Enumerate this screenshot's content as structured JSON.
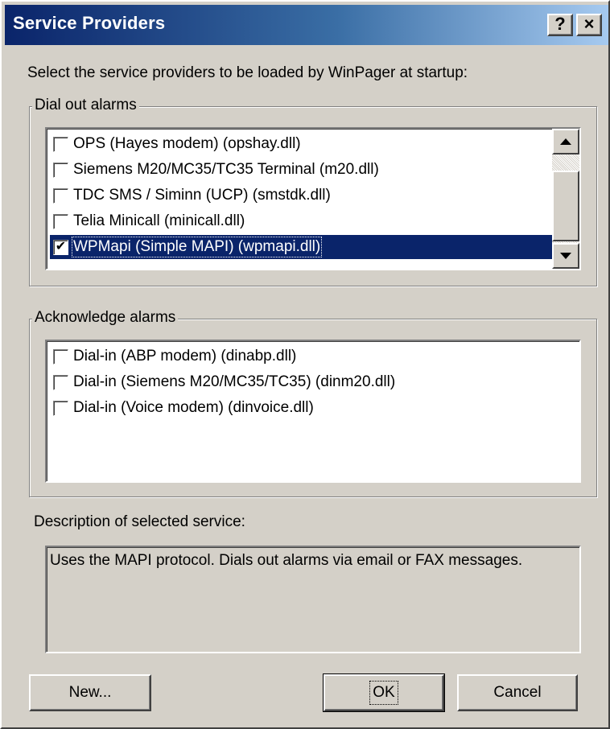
{
  "window": {
    "title": "Service Providers",
    "help_label": "?",
    "close_label": "×"
  },
  "intro_text": "Select the service providers to be loaded by WinPager at startup:",
  "dial_out": {
    "group_label": "Dial out alarms",
    "items": [
      {
        "label": "OPS (Hayes modem)   (opshay.dll)",
        "checked": false,
        "selected": false
      },
      {
        "label": "Siemens M20/MC35/TC35 Terminal   (m20.dll)",
        "checked": false,
        "selected": false
      },
      {
        "label": "TDC SMS / Siminn (UCP)   (smstdk.dll)",
        "checked": false,
        "selected": false
      },
      {
        "label": "Telia Minicall   (minicall.dll)",
        "checked": false,
        "selected": false
      },
      {
        "label": "WPMapi (Simple MAPI)   (wpmapi.dll)",
        "checked": true,
        "selected": true
      }
    ]
  },
  "acknowledge": {
    "group_label": "Acknowledge alarms",
    "items": [
      {
        "label": "Dial-in (ABP modem)   (dinabp.dll)",
        "checked": false
      },
      {
        "label": "Dial-in (Siemens M20/MC35/TC35)   (dinm20.dll)",
        "checked": false
      },
      {
        "label": "Dial-in (Voice modem)   (dinvoice.dll)",
        "checked": false
      }
    ]
  },
  "description": {
    "label": "Description of selected service:",
    "text": "Uses the MAPI protocol. Dials out alarms via email or FAX messages."
  },
  "buttons": {
    "new_label": "New...",
    "ok_label": "OK",
    "cancel_label": "Cancel"
  },
  "colors": {
    "face": "#d4d0c8",
    "title_start": "#0a246a",
    "title_end": "#a6caf0",
    "selection": "#0a246a"
  }
}
